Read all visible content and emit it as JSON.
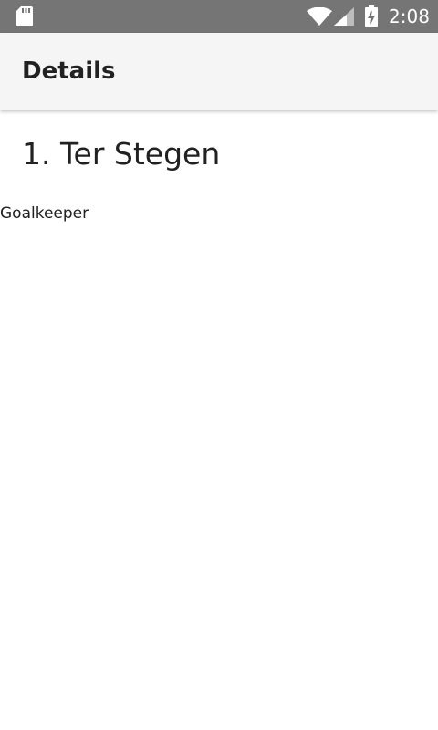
{
  "status_bar": {
    "time": "2:08",
    "icons": [
      "sd-card-icon",
      "wifi-icon",
      "signal-icon",
      "battery-charging-icon"
    ]
  },
  "app_bar": {
    "title": "Details"
  },
  "player": {
    "name": "1. Ter Stegen",
    "position": "Goalkeeper"
  }
}
